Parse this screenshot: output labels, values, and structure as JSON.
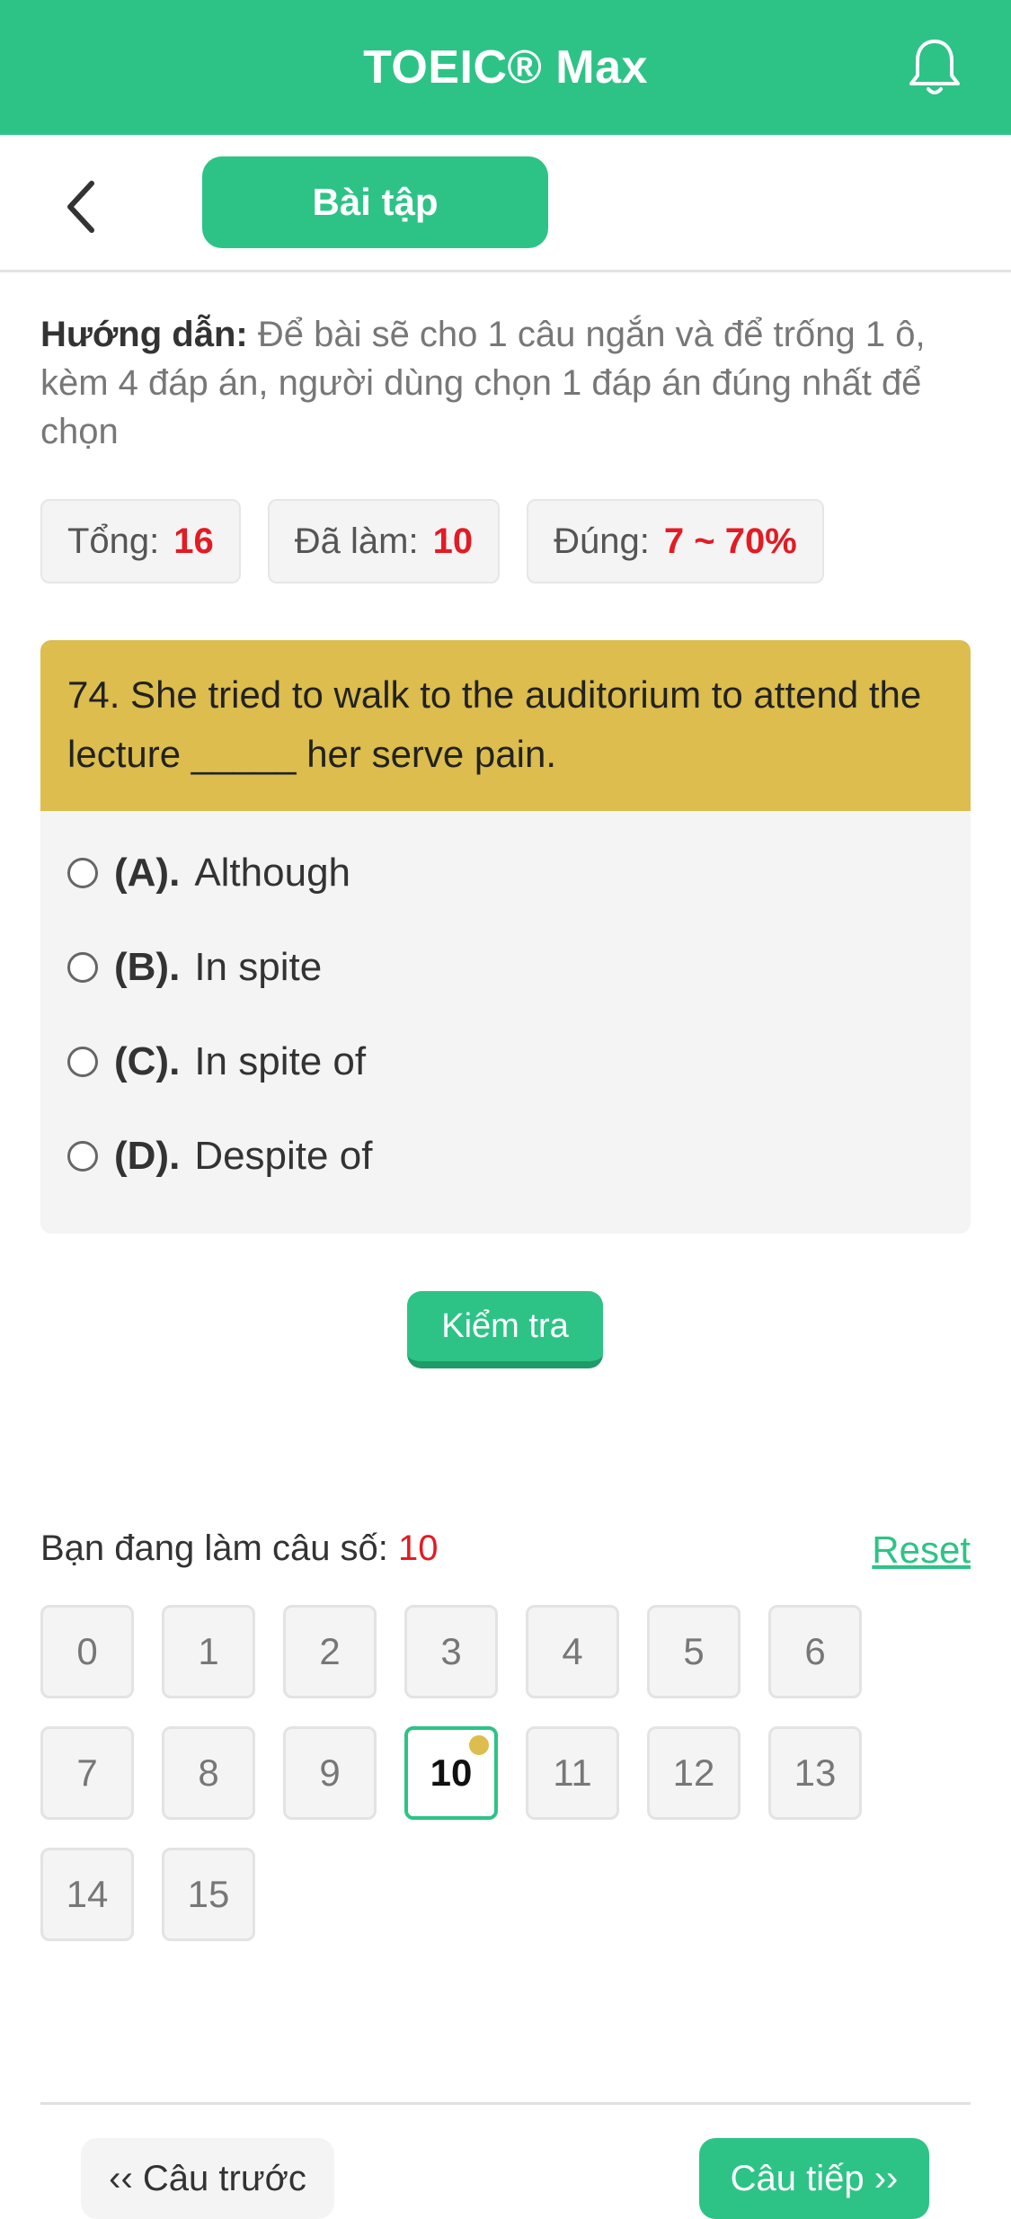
{
  "header": {
    "title": "TOEIC® Max",
    "notification_icon": "bell-icon",
    "color": "#2dc387"
  },
  "subheader": {
    "back_icon": "chevron-left-icon",
    "tab_label": "Bài tập"
  },
  "instruction": {
    "label": "Hướng dẫn:",
    "text": "Để bài sẽ cho 1 câu ngắn và để trống 1 ô, kèm 4 đáp án, người dùng chọn 1 đáp án đúng nhất để chọn"
  },
  "stats": {
    "total_label": "Tổng:",
    "total_value": "16",
    "done_label": "Đã làm:",
    "done_value": "10",
    "correct_label": "Đúng:",
    "correct_value": "7 ~ 70%"
  },
  "question": {
    "text": "74. She tried to walk to the auditorium to attend the lecture _____ her serve pain.",
    "options": [
      {
        "key": "(A).",
        "text": "Although"
      },
      {
        "key": "(B).",
        "text": "In spite"
      },
      {
        "key": "(C).",
        "text": "In spite of"
      },
      {
        "key": "(D).",
        "text": "Despite of"
      }
    ]
  },
  "check_button": "Kiểm tra",
  "progress": {
    "current_label": "Bạn đang làm câu số:",
    "current_value": "10",
    "reset_label": "Reset",
    "numbers": [
      "0",
      "1",
      "2",
      "3",
      "4",
      "5",
      "6",
      "7",
      "8",
      "9",
      "10",
      "11",
      "12",
      "13",
      "14",
      "15"
    ]
  },
  "navigation": {
    "prev_label": "‹‹ Câu trước",
    "next_label": "Câu tiếp ››"
  },
  "colors": {
    "accent": "#2dc387",
    "question_header": "#dcbd4d",
    "highlight_value": "#e31b23"
  }
}
